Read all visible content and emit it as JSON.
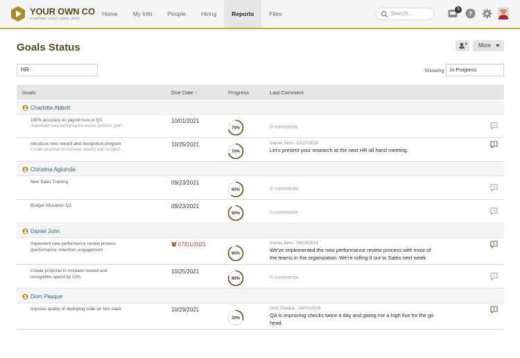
{
  "brand": {
    "name": "YOUR OWN CO",
    "tagline": "COMPANY LOGO GOES HERE"
  },
  "nav": {
    "items": [
      {
        "label": "Home",
        "active": false
      },
      {
        "label": "My Info",
        "active": false
      },
      {
        "label": "People",
        "active": false
      },
      {
        "label": "Hiring",
        "active": false
      },
      {
        "label": "Reports",
        "active": true
      },
      {
        "label": "Files",
        "active": false
      }
    ],
    "search_placeholder": "Search...",
    "inbox_count": "9"
  },
  "page": {
    "title": "Goals Status",
    "more_label": "More",
    "filter_value": "HR",
    "showing_label": "Showing",
    "showing_value": "In Progress"
  },
  "table": {
    "headers": {
      "goals": "Goals",
      "due_date": "Due Date",
      "progress": "Progress",
      "last_comment": "Last Comment"
    },
    "sort_arrow": "↑"
  },
  "groups": [
    {
      "person": "Charlotte Abbott",
      "goals": [
        {
          "title": "100% accuracy on payroll runs in Q3",
          "subtitle": "Implement new performance review process (perf...",
          "due": "10/01/2021",
          "overdue": false,
          "progress": 70,
          "progress_label": "70%",
          "comment_meta": "",
          "comment_lines": [
            "0 comments"
          ],
          "has_comment": false
        },
        {
          "title": "Introduce new reward and recognition program",
          "subtitle": "Create proposal to increase reward and recogniz...",
          "due": "10/25/2021",
          "overdue": false,
          "progress": 70,
          "progress_label": "70%",
          "comment_meta": "Daniel John - 01/27/2020",
          "comment_lines": [
            "Let's present your research at the next HR all hand meeting."
          ],
          "has_comment": true
        }
      ]
    },
    {
      "person": "Christina Agluinda",
      "goals": [
        {
          "title": "New Sales Training",
          "subtitle": "",
          "due": "09/23/2021",
          "overdue": false,
          "progress": 60,
          "progress_label": "60%",
          "comment_meta": "",
          "comment_lines": [
            "0 comments"
          ],
          "has_comment": false
        },
        {
          "title": "Budget Allocation Q2",
          "subtitle": "",
          "due": "09/23/2021",
          "overdue": false,
          "progress": 90,
          "progress_label": "90%",
          "comment_meta": "",
          "comment_lines": [
            "0 comments"
          ],
          "has_comment": false
        }
      ]
    },
    {
      "person": "Daniel John",
      "goals": [
        {
          "title": "Implement new performance review process",
          "subtitle": "(performance, retention, engagement",
          "due": "07/01/2021",
          "overdue": true,
          "progress": 90,
          "progress_label": "90%",
          "comment_meta": "Daniel John - 06/24/2021",
          "comment_lines": [
            "We've implemented the new performance review process with most of",
            "the teams in the organization. We're rolling it out to Sales next week"
          ],
          "has_comment": true
        },
        {
          "title": "Create proposal to increase reward and",
          "subtitle": "recognition spend by 10%",
          "due": "10/25/2021",
          "overdue": false,
          "progress": 80,
          "progress_label": "80%",
          "comment_meta": "",
          "comment_lines": [
            "0 comments"
          ],
          "has_comment": false
        }
      ]
    },
    {
      "person": "Dom Pasque",
      "goals": [
        {
          "title": "Improve quality of deploying code on fam stack",
          "subtitle": "",
          "due": "10/29/2021",
          "overdue": false,
          "progress": 30,
          "progress_label": "30%",
          "comment_meta": "Dom Pasque - 04/03/2019",
          "comment_lines": [
            "QA is improving checks twice a day and giving me a high five for the go",
            "head."
          ],
          "has_comment": true
        }
      ]
    }
  ],
  "colors": {
    "accent": "#c7a73a",
    "brand_text": "#5a4a1a",
    "progress_ring": "#6b4c10",
    "link": "#2a6680",
    "overdue": "#b03a20"
  },
  "icons": [
    "search-icon",
    "inbox-icon",
    "help-icon",
    "gear-icon",
    "avatar",
    "add-user-icon",
    "person-icon",
    "alarm-icon",
    "comment-icon"
  ]
}
